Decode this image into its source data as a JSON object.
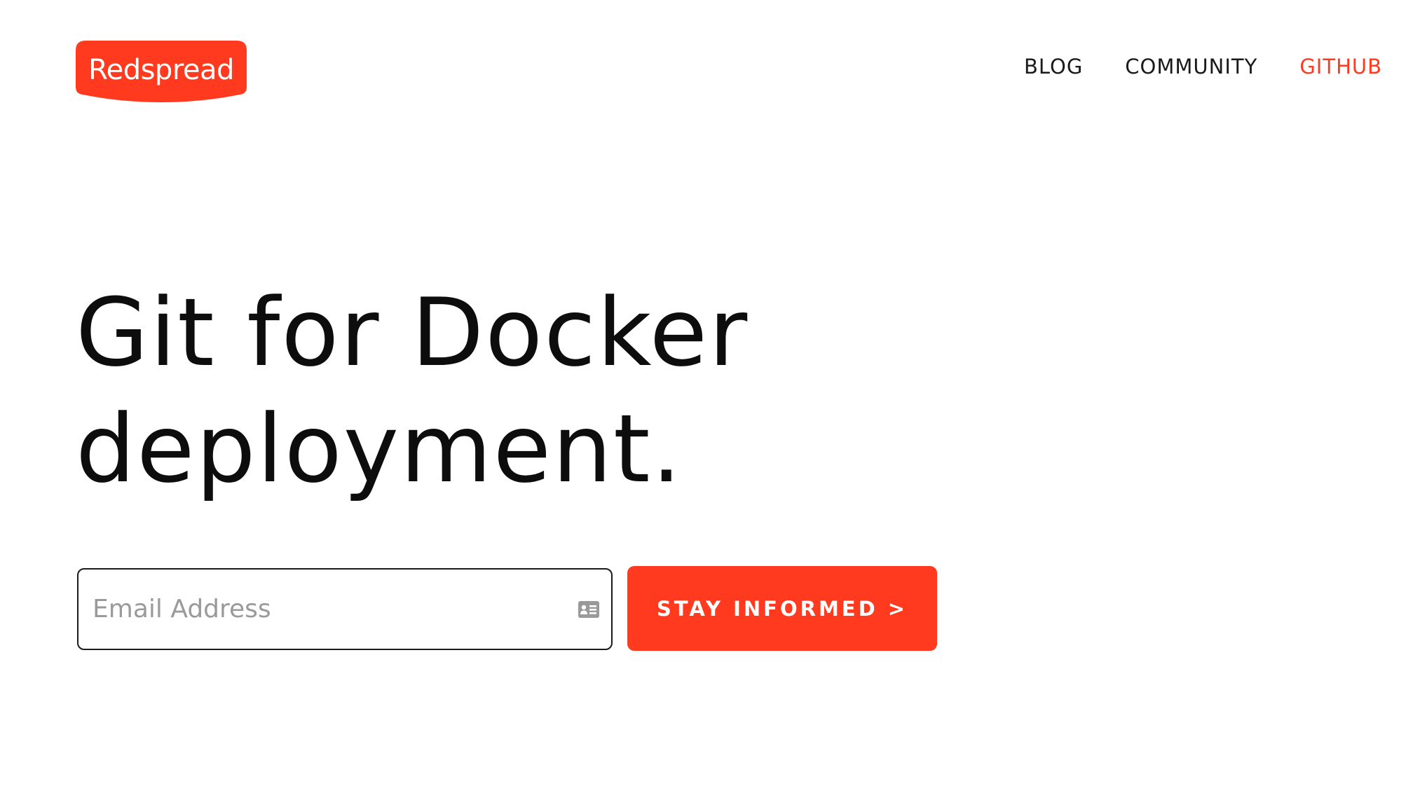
{
  "brand": {
    "logo_text": "Redspread",
    "accent_color": "#ff3a1f"
  },
  "nav": {
    "items": [
      {
        "label": "BLOG",
        "active": false
      },
      {
        "label": "COMMUNITY",
        "active": false
      },
      {
        "label": "GITHUB",
        "active": true
      }
    ]
  },
  "hero": {
    "title_line1": "Git for Docker",
    "title_line2": "deployment."
  },
  "signup": {
    "email_placeholder": "Email Address",
    "email_value": "",
    "email_icon": "contact-card-icon",
    "button_label": "STAY INFORMED >"
  }
}
